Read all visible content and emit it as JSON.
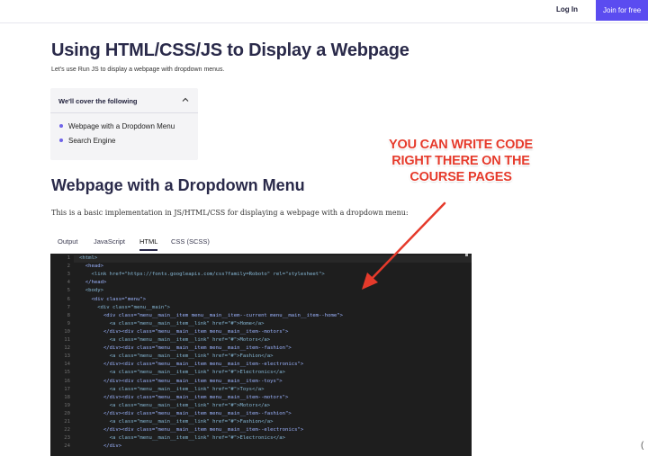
{
  "header": {
    "login_label": "Log In",
    "join_label": "Join for free"
  },
  "page": {
    "title": "Using HTML/CSS/JS to Display a Webpage",
    "subtitle": "Let's use Run JS to display a webpage with dropdown menus."
  },
  "toc": {
    "heading": "We'll cover the following",
    "items": [
      "Webpage with a Dropdown Menu",
      "Search Engine"
    ]
  },
  "callout": {
    "lines": [
      "YOU CAN WRITE CODE",
      "RIGHT THERE ON THE",
      "COURSE PAGES"
    ],
    "color": "#e53a2b"
  },
  "section": {
    "heading": "Webpage with a Dropdown Menu",
    "description": "This is a basic implementation in JS/HTML/CSS for displaying a webpage with a dropdown menu:"
  },
  "tabs": [
    "Output",
    "JavaScript",
    "HTML",
    "CSS (SCSS)"
  ],
  "active_tab": "HTML",
  "editor": {
    "line_numbers": [
      "1",
      "2",
      "3",
      "4",
      "5",
      "6",
      "7",
      "8",
      "9",
      "10",
      "11",
      "12",
      "13",
      "14",
      "15",
      "16",
      "17",
      "18",
      "19",
      "20",
      "21",
      "22",
      "23",
      "24"
    ],
    "lines": [
      "<html>",
      "  <head>",
      "    <link href=\"https://fonts.googleapis.com/css?family=Roboto\" rel=\"stylesheet\">",
      "  </head>",
      "  <body>",
      "    <div class=\"menu\">",
      "      <div class=\"menu__main\">",
      "        <div class=\"menu__main__item menu__main__item--current menu__main__item--home\">",
      "          <a class=\"menu__main__item__link\" href=\"#\">Home</a>",
      "        </div><div class=\"menu__main__item menu__main__item--motors\">",
      "          <a class=\"menu__main__item__link\" href=\"#\">Motors</a>",
      "        </div><div class=\"menu__main__item menu__main__item--fashion\">",
      "          <a class=\"menu__main__item__link\" href=\"#\">Fashion</a>",
      "        </div><div class=\"menu__main__item menu__main__item--electronics\">",
      "          <a class=\"menu__main__item__link\" href=\"#\">Electronics</a>",
      "        </div><div class=\"menu__main__item menu__main__item--toys\">",
      "          <a class=\"menu__main__item__link\" href=\"#\">Toys</a>",
      "        </div><div class=\"menu__main__item menu__main__item--motors\">",
      "          <a class=\"menu__main__item__link\" href=\"#\">Motors</a>",
      "        </div><div class=\"menu__main__item menu__main__item--fashion\">",
      "          <a class=\"menu__main__item__link\" href=\"#\">Fashion</a>",
      "        </div><div class=\"menu__main__item menu__main__item--electronics\">",
      "          <a class=\"menu__main__item__link\" href=\"#\">Electronics</a>",
      "        </div>"
    ]
  },
  "colors": {
    "accent": "#5b4cf0",
    "editor_bg": "#1e1e1e",
    "bullet": "#6f63e8"
  }
}
